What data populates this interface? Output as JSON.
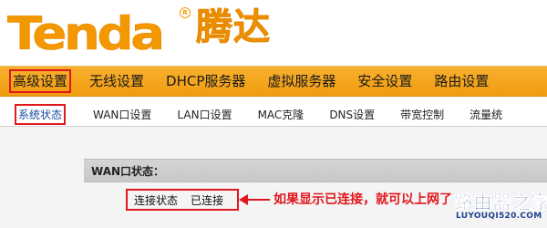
{
  "brand": {
    "logo_latin": "Tenda",
    "logo_cn": "腾达",
    "registered_mark": "R"
  },
  "top_menu": {
    "items": [
      {
        "label": "高级设置",
        "active": true
      },
      {
        "label": "无线设置",
        "active": false
      },
      {
        "label": "DHCP服务器",
        "active": false
      },
      {
        "label": "虚拟服务器",
        "active": false
      },
      {
        "label": "安全设置",
        "active": false
      },
      {
        "label": "路由设置",
        "active": false
      }
    ]
  },
  "sub_menu": {
    "items": [
      {
        "label": "系统状态",
        "active": true
      },
      {
        "label": "WAN口设置",
        "active": false
      },
      {
        "label": "LAN口设置",
        "active": false
      },
      {
        "label": "MAC克隆",
        "active": false
      },
      {
        "label": "DNS设置",
        "active": false
      },
      {
        "label": "带宽控制",
        "active": false
      },
      {
        "label": "流量统",
        "active": false
      }
    ]
  },
  "wan_status": {
    "section_title": "WAN口状态：",
    "connection_label": "连接状态",
    "connection_value": "已连接"
  },
  "annotation": {
    "text": "如果显示已连接，就可以上网了"
  },
  "watermark": {
    "cn": "路由器之家",
    "url": "LUYOUQI520.COM"
  },
  "colors": {
    "brand_orange": "#f39800",
    "menu_orange": "#f29c10",
    "highlight_red": "#e0181e",
    "watermark_blue": "#1f3f8f"
  }
}
